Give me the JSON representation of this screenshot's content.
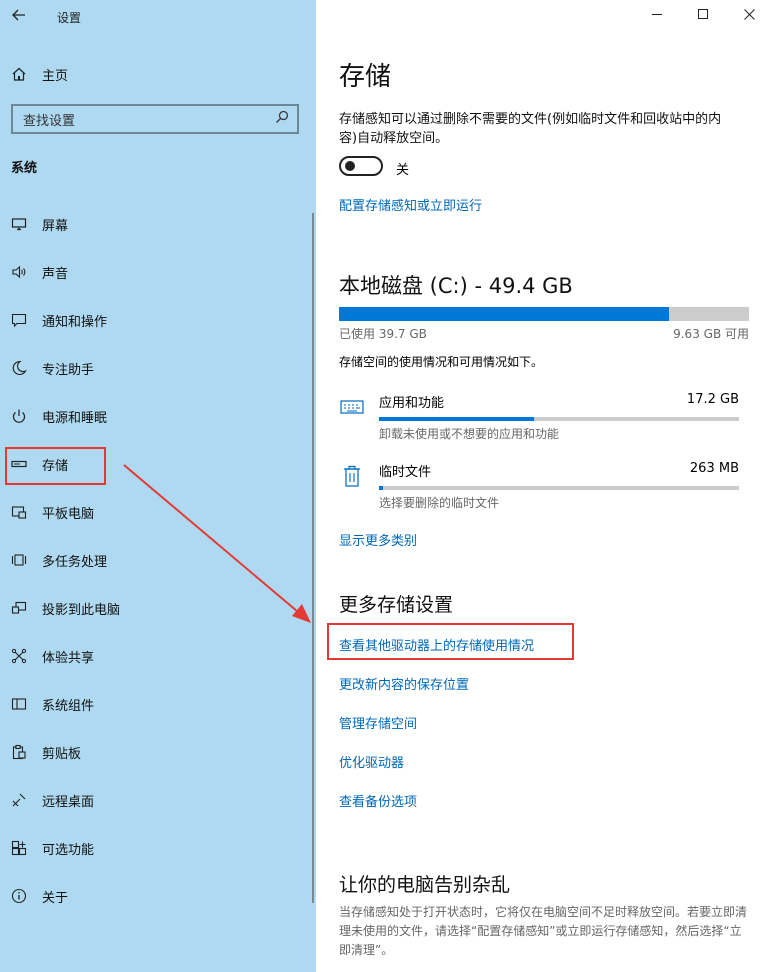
{
  "window": {
    "title": "设置"
  },
  "sidebar": {
    "home_label": "主页",
    "search_placeholder": "查找设置",
    "section_title": "系统",
    "items": [
      {
        "label": "屏幕",
        "icon": "monitor-icon"
      },
      {
        "label": "声音",
        "icon": "speaker-icon"
      },
      {
        "label": "通知和操作",
        "icon": "message-icon"
      },
      {
        "label": "专注助手",
        "icon": "moon-icon"
      },
      {
        "label": "电源和睡眠",
        "icon": "power-icon"
      },
      {
        "label": "存储",
        "icon": "storage-drive-icon",
        "selected": true
      },
      {
        "label": "平板电脑",
        "icon": "tablet-icon"
      },
      {
        "label": "多任务处理",
        "icon": "multitask-icon"
      },
      {
        "label": "投影到此电脑",
        "icon": "project-icon"
      },
      {
        "label": "体验共享",
        "icon": "share-icon"
      },
      {
        "label": "系统组件",
        "icon": "components-icon"
      },
      {
        "label": "剪贴板",
        "icon": "clipboard-icon"
      },
      {
        "label": "远程桌面",
        "icon": "remote-icon"
      },
      {
        "label": "可选功能",
        "icon": "optional-features-icon"
      },
      {
        "label": "关于",
        "icon": "info-icon"
      }
    ]
  },
  "main": {
    "title": "存储",
    "storage_sense_desc": "存储感知可以通过删除不需要的文件(例如临时文件和回收站中的内容)自动释放空间。",
    "toggle_state": "关",
    "configure_link": "配置存储感知或立即运行",
    "disk": {
      "title": "本地磁盘 (C:) - 49.4 GB",
      "used_label": "已使用 39.7 GB",
      "free_label": "9.63 GB 可用",
      "used_fraction": 0.804,
      "summary": "存储空间的使用情况和可用情况如下。"
    },
    "categories": [
      {
        "name": "应用和功能",
        "size": "17.2 GB",
        "desc": "卸载未使用或不想要的应用和功能",
        "fraction": 0.43,
        "icon": "keyboard-icon"
      },
      {
        "name": "临时文件",
        "size": "263 MB",
        "desc": "选择要删除的临时文件",
        "fraction": 0.01,
        "icon": "trash-icon"
      }
    ],
    "show_more_link": "显示更多类别",
    "more_settings_title": "更多存储设置",
    "more_links": [
      "查看其他驱动器上的存储使用情况",
      "更改新内容的保存位置",
      "管理存储空间",
      "优化驱动器",
      "查看备份选项"
    ],
    "declutter_title": "让你的电脑告别杂乱",
    "declutter_desc": "当存储感知处于打开状态时，它将仅在电脑空间不足时释放空间。若要立即清理未使用的文件，请选择“配置存储感知”或立即运行存储感知，然后选择“立即清理”。"
  },
  "colors": {
    "accent": "#0078d7",
    "link": "#0067b8",
    "sidebar_bg": "#aed9f0",
    "highlight": "#e53935"
  }
}
